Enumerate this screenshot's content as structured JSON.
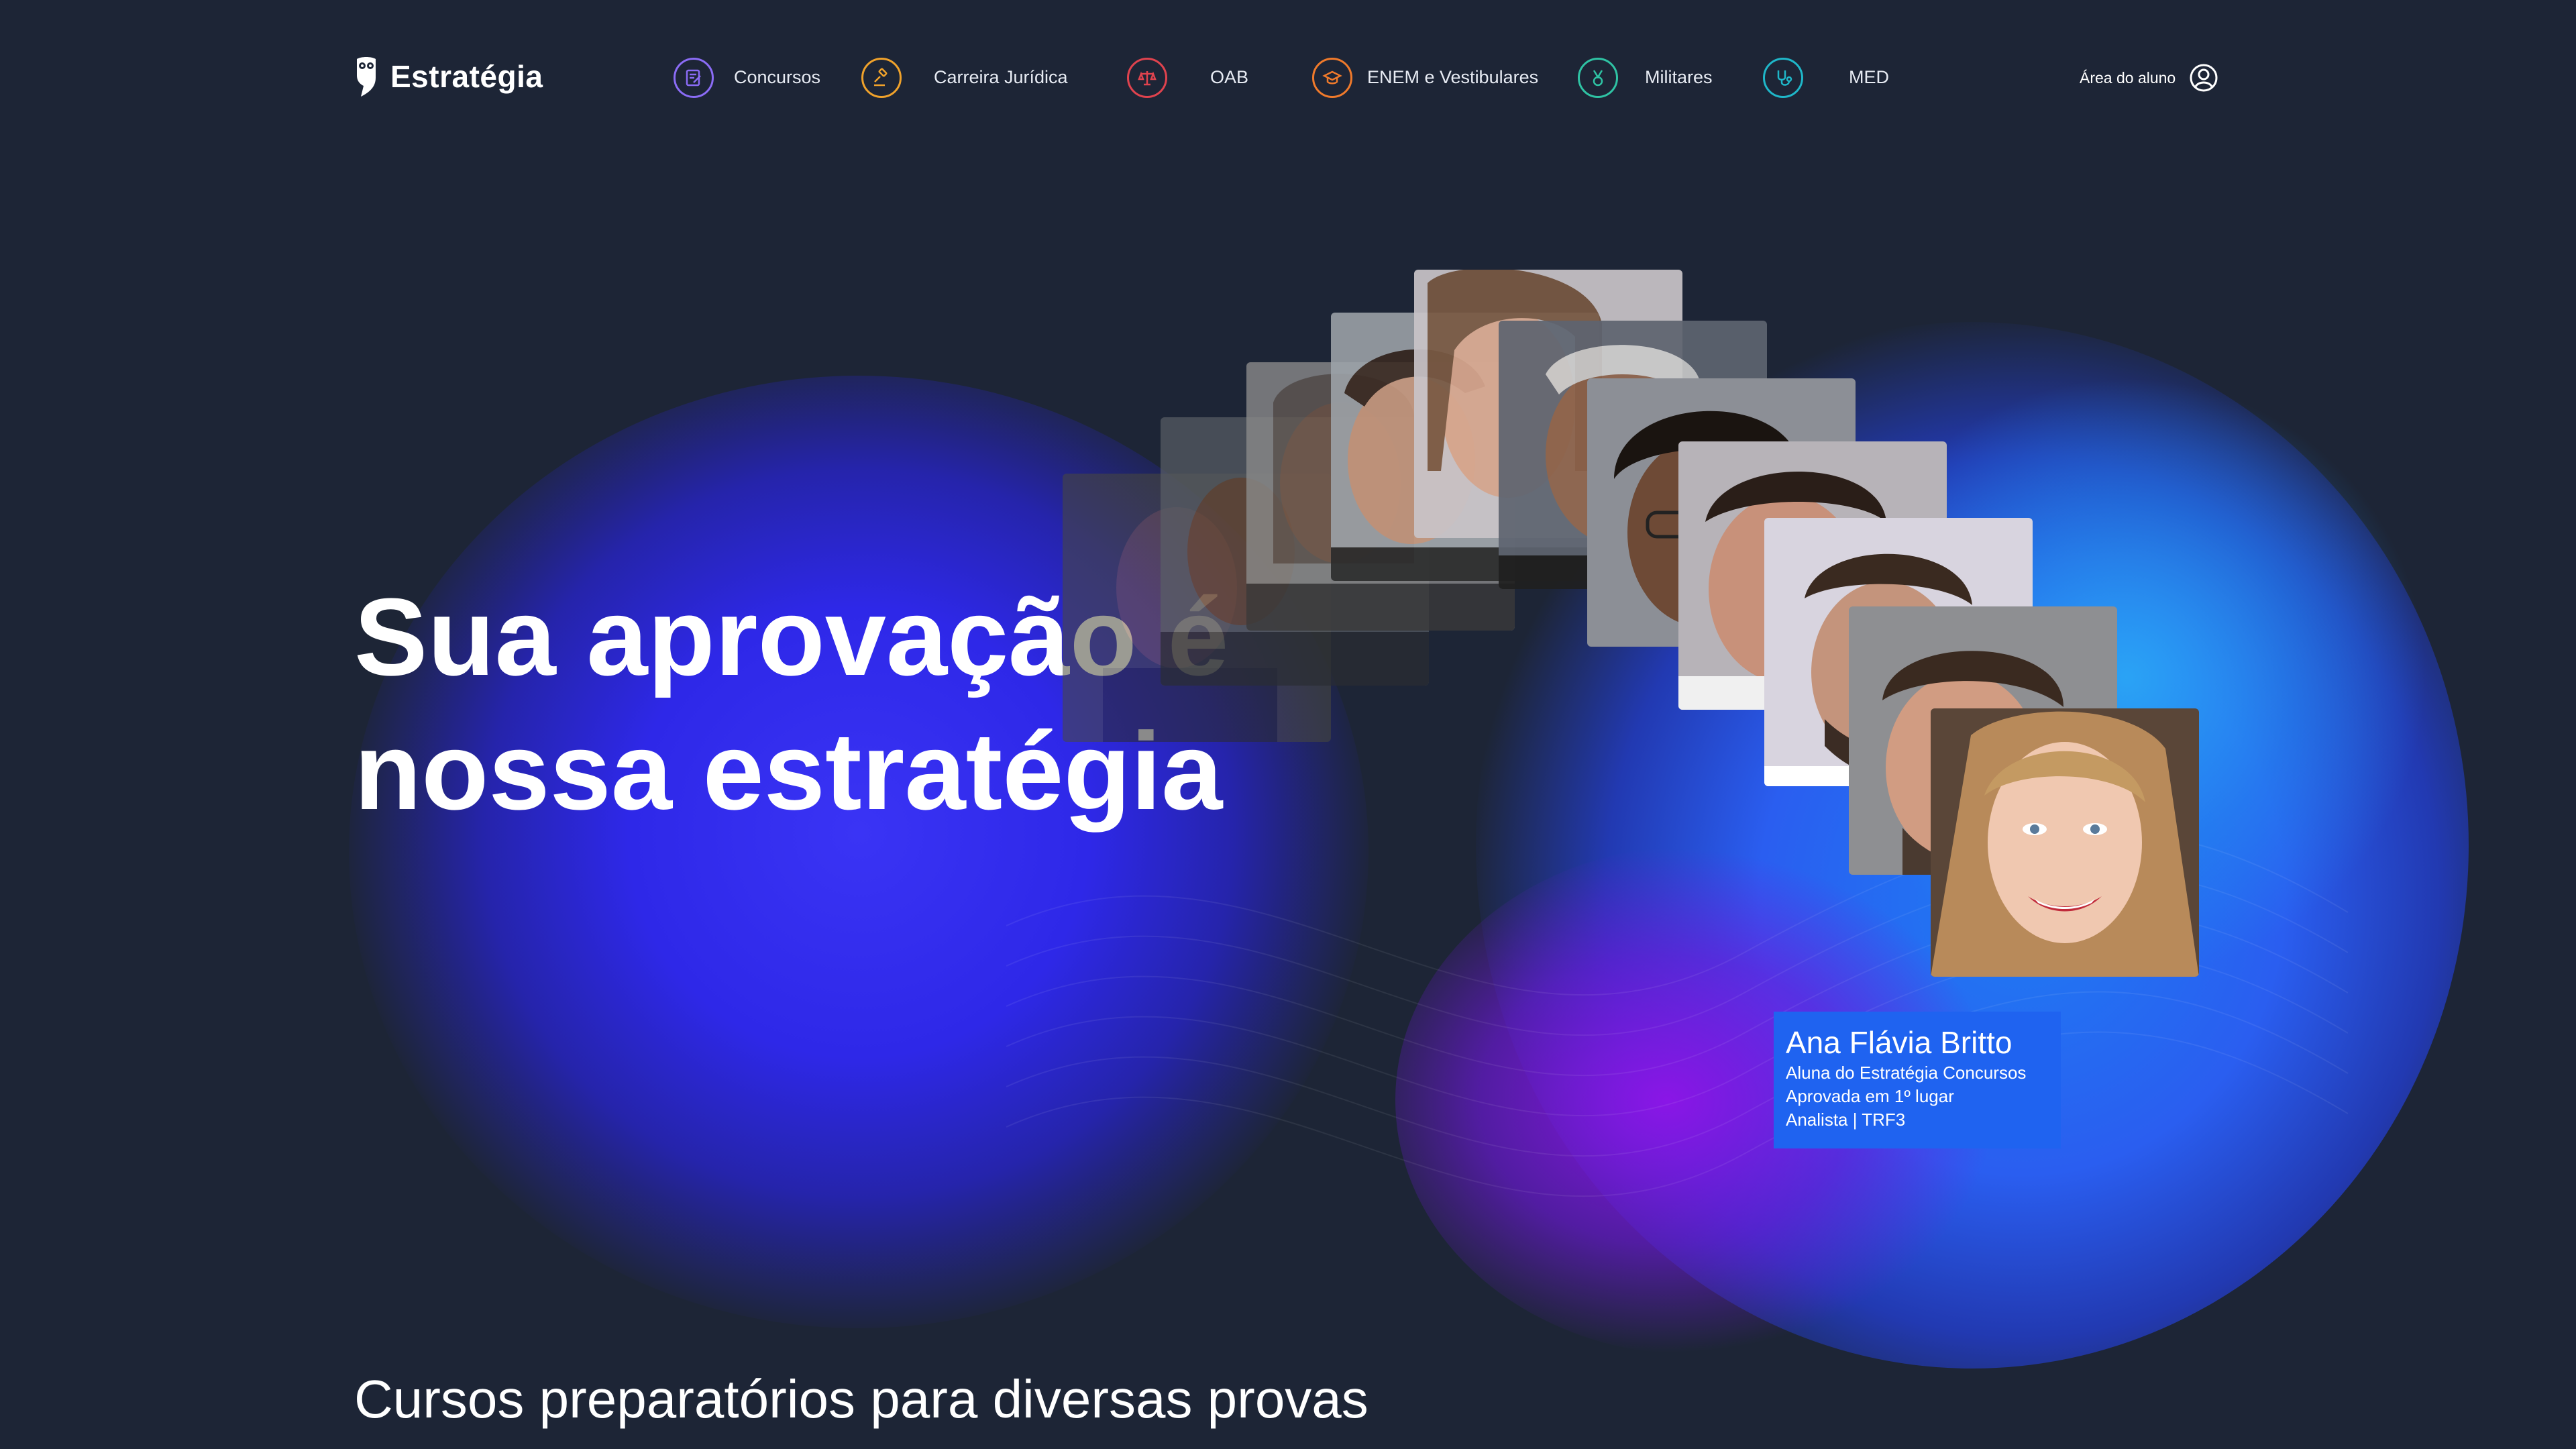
{
  "brand": {
    "name": "Estratégia"
  },
  "nav": {
    "items": [
      {
        "label": "Concursos",
        "icon": "document-edit-icon",
        "color": "#8b6cf6"
      },
      {
        "label": "Carreira Jurídica",
        "icon": "gavel-icon",
        "color": "#f0a22b"
      },
      {
        "label": "OAB",
        "icon": "scales-icon",
        "color": "#e0434e"
      },
      {
        "label": "ENEM e Vestibulares",
        "icon": "graduation-cap-icon",
        "color": "#f07a2b"
      },
      {
        "label": "Militares",
        "icon": "medal-icon",
        "color": "#2fc3a4"
      },
      {
        "label": "MED",
        "icon": "stethoscope-icon",
        "color": "#1fb7c9"
      }
    ],
    "student_area": {
      "label": "Área do aluno",
      "icon": "user-circle-icon"
    }
  },
  "hero": {
    "title_line1": "Sua aprovação é",
    "title_line2": "nossa estratégia"
  },
  "testimonial": {
    "name": "Ana Flávia Britto",
    "line1": "Aluna do Estratégia Concursos",
    "line2": "Aprovada em 1º lugar",
    "line3": "Analista | TRF3"
  },
  "section": {
    "subtitle": "Cursos preparatórios para diversas provas"
  },
  "colors": {
    "background": "#1d2536",
    "accent_blue": "#1f63f0",
    "blob_indigo": "#3a34f5",
    "blob_purple": "#8a16e6"
  }
}
